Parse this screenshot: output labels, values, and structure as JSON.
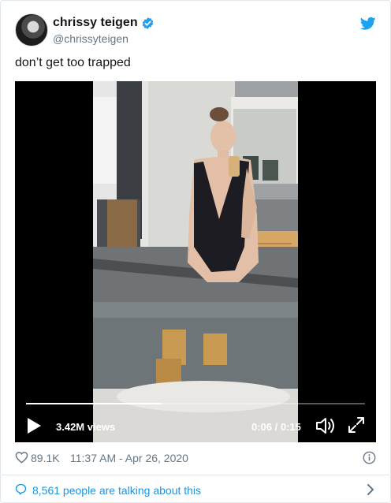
{
  "tweet": {
    "display_name": "chrissy teigen",
    "handle": "@chrissyteigen",
    "text": "don’t get too trapped"
  },
  "video": {
    "views": "3.42M views",
    "time": "0:06 / 0:15",
    "progress": 0.4
  },
  "meta": {
    "likes": "89.1K",
    "timestamp": "11:37 AM - Apr 26, 2020"
  },
  "conversation": {
    "label": "8,561 people are talking about this"
  },
  "icons": {
    "verified": "verified-badge-icon",
    "brand": "twitter-bird-icon",
    "like": "heart-icon",
    "info": "info-icon",
    "reply": "speech-bubble-icon",
    "chevron": "chevron-right-icon",
    "play": "play-icon",
    "volume": "volume-icon",
    "fullscreen": "fullscreen-icon"
  },
  "colors": {
    "accent": "#1da1f2",
    "link": "#1b95e0",
    "muted": "#657786",
    "text": "#14171a"
  }
}
